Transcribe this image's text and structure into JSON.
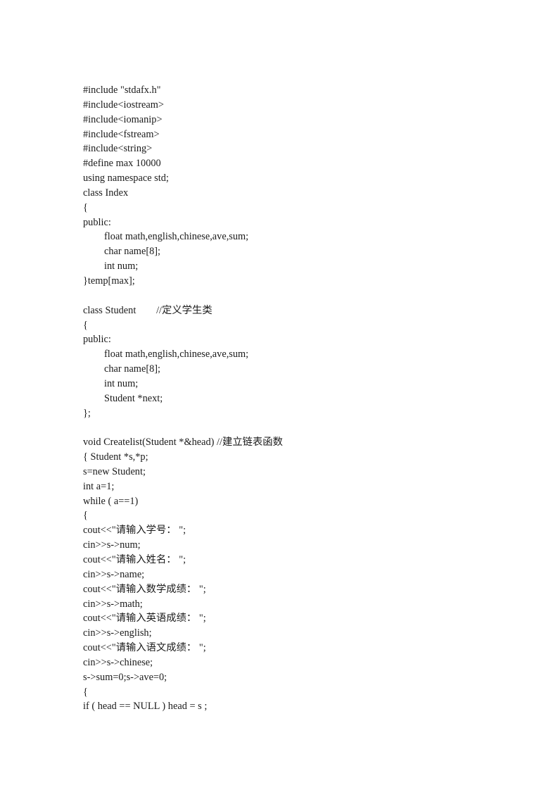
{
  "document": {
    "type": "source-code-listing",
    "language": "C++",
    "page_background": "#ffffff",
    "text_color": "#1a1a1a",
    "lines": [
      {
        "text": "#include \"stdafx.h\"",
        "indent": 0
      },
      {
        "text": "#include<iostream>",
        "indent": 0
      },
      {
        "text": "#include<iomanip>",
        "indent": 0
      },
      {
        "text": "#include<fstream>",
        "indent": 0
      },
      {
        "text": "#include<string>",
        "indent": 0
      },
      {
        "text": "#define max 10000",
        "indent": 0
      },
      {
        "text": "using namespace std;",
        "indent": 0
      },
      {
        "text": "class Index",
        "indent": 0
      },
      {
        "text": "{",
        "indent": 0
      },
      {
        "text": "public:",
        "indent": 0
      },
      {
        "text": "float math,english,chinese,ave,sum;",
        "indent": 1
      },
      {
        "text": "char name[8];",
        "indent": 1
      },
      {
        "text": "int num;",
        "indent": 1
      },
      {
        "text": "}temp[max];",
        "indent": 0
      },
      {
        "text": "",
        "indent": 0
      },
      {
        "text": "class Student        //定义学生类",
        "indent": 0
      },
      {
        "text": "{",
        "indent": 0
      },
      {
        "text": "public:",
        "indent": 0
      },
      {
        "text": "float math,english,chinese,ave,sum;",
        "indent": 1
      },
      {
        "text": "char name[8];",
        "indent": 1
      },
      {
        "text": "int num;",
        "indent": 1
      },
      {
        "text": "Student *next;",
        "indent": 1
      },
      {
        "text": "};",
        "indent": 0
      },
      {
        "text": "",
        "indent": 0
      },
      {
        "text": "void Createlist(Student *&head) //建立链表函数",
        "indent": 0
      },
      {
        "text": "{ Student *s,*p;",
        "indent": 0
      },
      {
        "text": "s=new Student;",
        "indent": 0
      },
      {
        "text": "int a=1;",
        "indent": 0
      },
      {
        "text": "while ( a==1)",
        "indent": 0
      },
      {
        "text": "{",
        "indent": 0
      },
      {
        "text": "cout<<\"请输入学号： \";",
        "indent": 0
      },
      {
        "text": "cin>>s->num;",
        "indent": 0
      },
      {
        "text": "cout<<\"请输入姓名： \";",
        "indent": 0
      },
      {
        "text": "cin>>s->name;",
        "indent": 0
      },
      {
        "text": "cout<<\"请输入数学成绩： \";",
        "indent": 0
      },
      {
        "text": "cin>>s->math;",
        "indent": 0
      },
      {
        "text": "cout<<\"请输入英语成绩： \";",
        "indent": 0
      },
      {
        "text": "cin>>s->english;",
        "indent": 0
      },
      {
        "text": "cout<<\"请输入语文成绩： \";",
        "indent": 0
      },
      {
        "text": "cin>>s->chinese;",
        "indent": 0
      },
      {
        "text": "s->sum=0;s->ave=0;",
        "indent": 0
      },
      {
        "text": "{",
        "indent": 0
      },
      {
        "text": "if ( head == NULL ) head = s ;",
        "indent": 0
      }
    ]
  }
}
